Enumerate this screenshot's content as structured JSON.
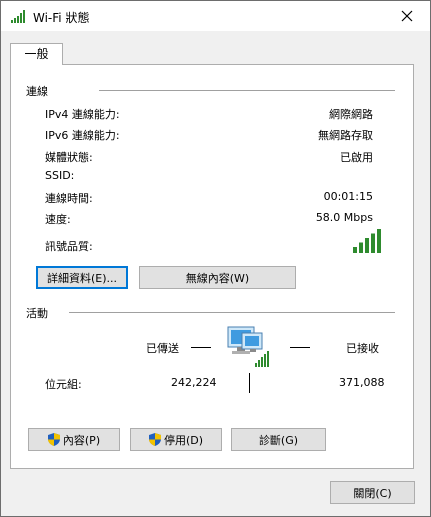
{
  "window": {
    "title": "Wi-Fi 狀態",
    "icon": "wifi-signal-icon",
    "close_icon": "close-icon"
  },
  "tabs": [
    {
      "label": "一般",
      "selected": true
    }
  ],
  "connection": {
    "group_label": "連線",
    "rows": [
      {
        "label": "IPv4 連線能力:",
        "value": "網際網路"
      },
      {
        "label": "IPv6 連線能力:",
        "value": "無網路存取"
      },
      {
        "label": "媒體狀態:",
        "value": "已啟用"
      },
      {
        "label": "SSID:",
        "value": ""
      },
      {
        "label": "連線時間:",
        "value": "00:01:15"
      },
      {
        "label": "速度:",
        "value": "58.0 Mbps"
      }
    ],
    "signal_label": "訊號品質:",
    "signal_bars": 5,
    "details_button": "詳細資料(E)...",
    "wireless_props_button": "無線內容(W)"
  },
  "activity": {
    "group_label": "活動",
    "sent_label": "已傳送",
    "received_label": "已接收",
    "bytes_label": "位元組:",
    "bytes_sent": "242,224",
    "bytes_received": "371,088",
    "network_icon": "network-computer-icon"
  },
  "buttons": {
    "properties": "內容(P)",
    "disable": "停用(D)",
    "diagnose": "診斷(G)",
    "close": "關閉(C)"
  },
  "colors": {
    "accent": "#0078d7",
    "signal_green": "#2e8b2e",
    "window_bg": "#f0f0f0",
    "panel_bg": "#ffffff",
    "button_bg": "#e1e1e1"
  }
}
